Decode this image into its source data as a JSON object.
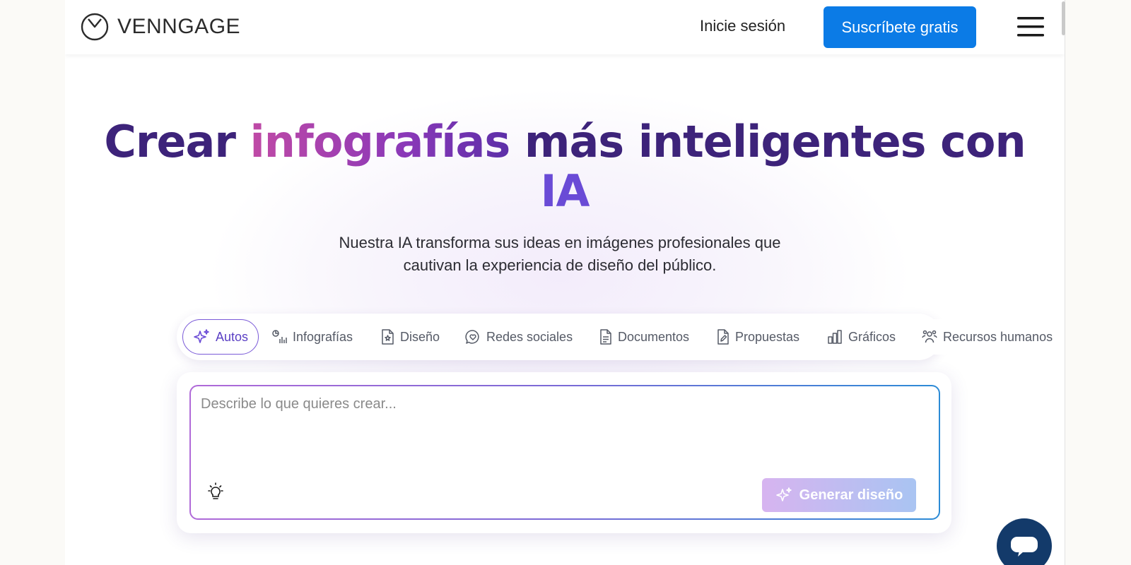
{
  "header": {
    "logo_text": "VENNGAGE",
    "signin_label": "Inicie sesión",
    "signup_label": "Suscríbete gratis"
  },
  "hero": {
    "title_part1": "Crear ",
    "title_highlight": "infografías",
    "title_part2": " más inteligentes con",
    "title_ia": "IA",
    "subtitle": "Nuestra IA transforma sus ideas en imágenes profesionales que cautivan la experiencia de diseño del público."
  },
  "tabs": [
    {
      "label": "Autos",
      "icon": "sparkles-icon",
      "active": true
    },
    {
      "label": "Infografías",
      "icon": "chart-icon"
    },
    {
      "label": "Diseño",
      "icon": "design-doc-icon"
    },
    {
      "label": "Redes sociales",
      "icon": "chat-heart-icon"
    },
    {
      "label": "Documentos",
      "icon": "document-icon"
    },
    {
      "label": "Propuestas",
      "icon": "pen-doc-icon"
    },
    {
      "label": "Gráficos",
      "icon": "bar-chart-icon"
    },
    {
      "label": "Recursos humanos",
      "icon": "people-icon"
    }
  ],
  "prompt": {
    "placeholder": "Describe lo que quieres crear...",
    "value": "",
    "generate_label": "Generar diseño"
  },
  "colors": {
    "brand_blue": "#0b7be6",
    "title_purple": "#3d237a",
    "accent_purple": "#6a4bd6",
    "chat_navy": "#133a6a"
  }
}
